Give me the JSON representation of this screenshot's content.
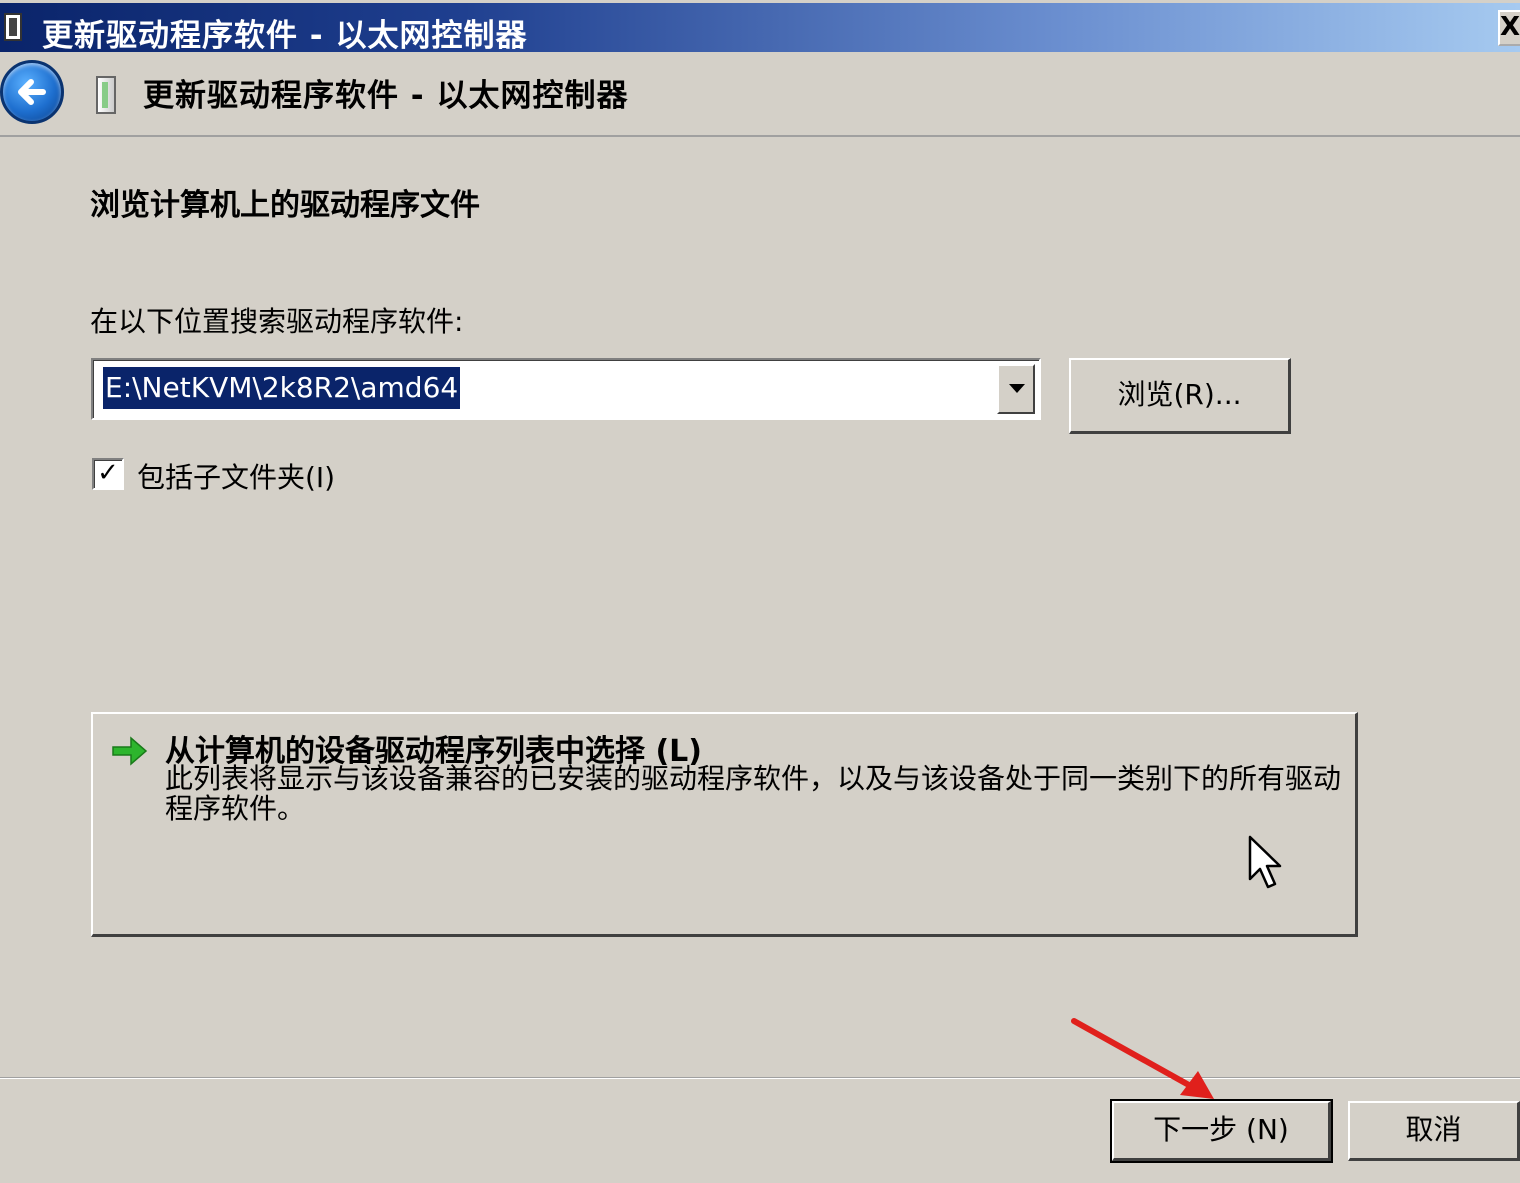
{
  "window": {
    "title": "更新驱动程序软件 - 以太网控制器",
    "close_label": "X"
  },
  "header": {
    "title": "更新驱动程序软件 - 以太网控制器"
  },
  "main": {
    "section_title": "浏览计算机上的驱动程序文件",
    "search_label": "在以下位置搜索驱动程序软件:",
    "path_value": "E:\\NetKVM\\2k8R2\\amd64",
    "browse_label": "浏览(R)...",
    "include_subfolders": {
      "label": "包括子文件夹(I)",
      "checked": true,
      "mark": "✓"
    },
    "choose_from_list": {
      "title": "从计算机的设备驱动程序列表中选择 (L)",
      "description": "此列表将显示与该设备兼容的已安装的驱动程序软件，以及与该设备处于同一类别下的所有驱动程序软件。"
    }
  },
  "footer": {
    "next_label": "下一步 (N)",
    "cancel_label": "取消"
  },
  "colors": {
    "dialog_bg": "#d4d0c8",
    "titlebar_start": "#0a246a",
    "titlebar_end": "#a6caf0",
    "selection_bg": "#0a246a",
    "green_arrow": "#2db52d",
    "annotation_arrow": "#e0201c"
  },
  "icons": {
    "window": "device-icon",
    "back": "back-arrow-icon",
    "command_link": "green-arrow-icon",
    "pointer": "mouse-cursor-icon",
    "annotation": "red-arrow-annotation"
  }
}
